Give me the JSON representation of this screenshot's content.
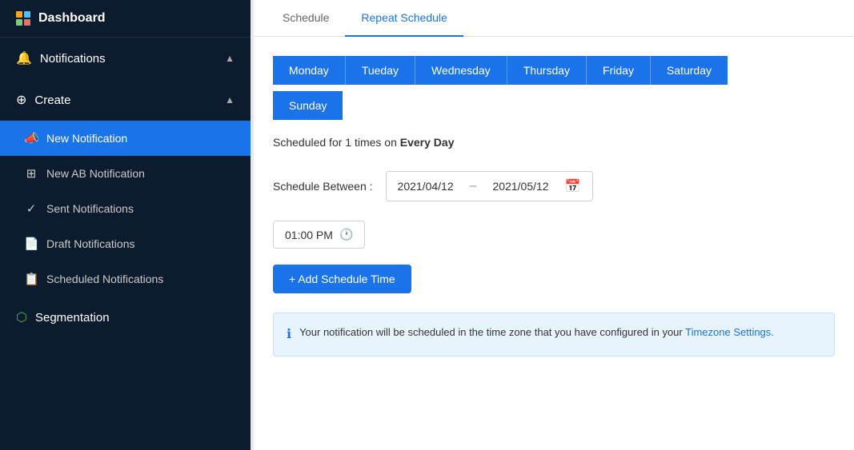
{
  "sidebar": {
    "logo": {
      "label": "Dashboard"
    },
    "notifications_section": {
      "label": "Notifications",
      "icon": "🔔"
    },
    "create_section": {
      "label": "Create",
      "icon": "⊕"
    },
    "items": [
      {
        "id": "new-notification",
        "label": "New Notification",
        "icon": "📣",
        "active": true
      },
      {
        "id": "new-ab-notification",
        "label": "New AB Notification",
        "icon": "⊞",
        "active": false
      },
      {
        "id": "sent-notifications",
        "label": "Sent Notifications",
        "icon": "✓",
        "active": false
      },
      {
        "id": "draft-notifications",
        "label": "Draft Notifications",
        "icon": "📄",
        "active": false
      },
      {
        "id": "scheduled-notifications",
        "label": "Scheduled Notifications",
        "icon": "📋",
        "active": false
      }
    ],
    "segmentation": {
      "label": "Segmentation",
      "icon": "⬡"
    }
  },
  "tabs": [
    {
      "id": "schedule",
      "label": "Schedule",
      "active": false
    },
    {
      "id": "repeat-schedule",
      "label": "Repeat Schedule",
      "active": true
    }
  ],
  "days": {
    "row1": [
      "Monday",
      "Tueday",
      "Wednesday",
      "Thursday",
      "Friday",
      "Saturday"
    ],
    "row2": [
      "Sunday"
    ]
  },
  "schedule_text_prefix": "Scheduled for 1 times on ",
  "schedule_text_bold": "Every Day",
  "schedule_between": {
    "label": "Schedule Between :",
    "start_date": "2021/04/12",
    "end_date": "2021/05/12"
  },
  "time": {
    "value": "01:00 PM"
  },
  "add_time_btn": "+ Add Schedule Time",
  "info_message": {
    "text_before": "Your notification will be scheduled in the time zone that you have configured in your ",
    "link_text": "Timezone Settings.",
    "text_after": ""
  }
}
